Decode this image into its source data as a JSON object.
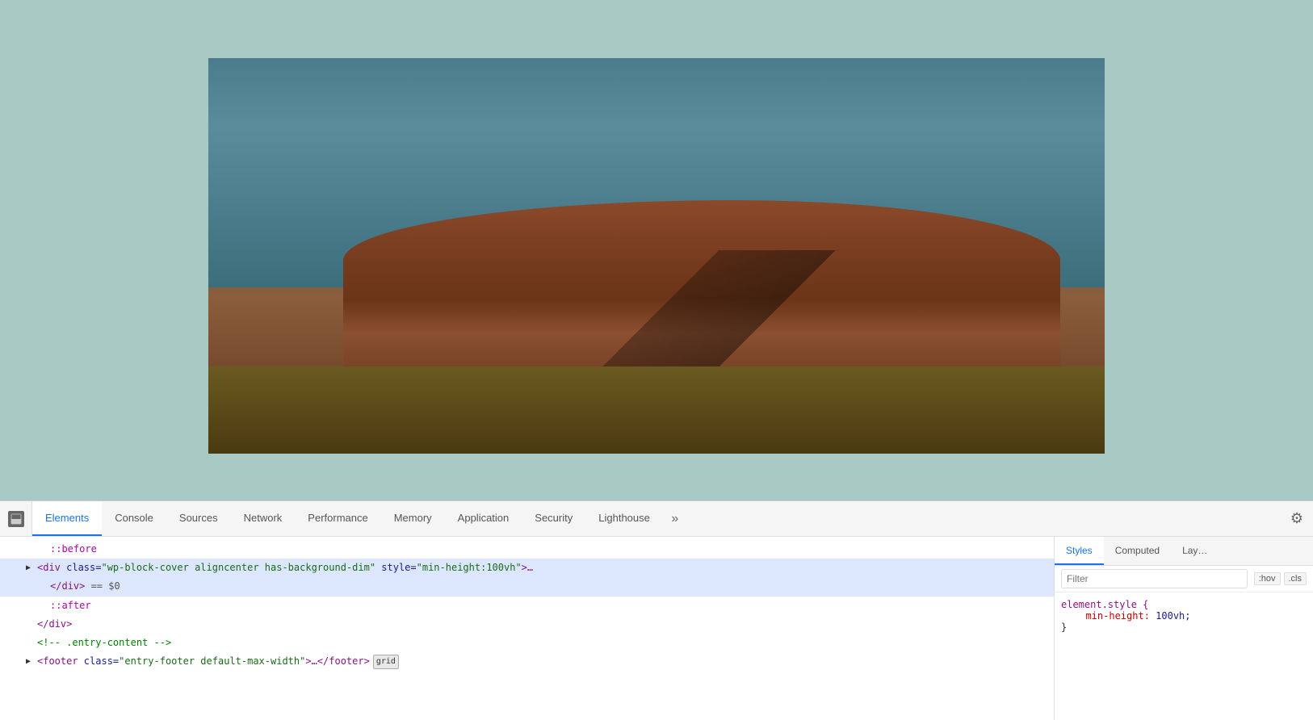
{
  "viewport": {
    "bg_color": "#a8c8c4"
  },
  "devtools": {
    "tabs": [
      {
        "id": "elements",
        "label": "Elements",
        "active": true
      },
      {
        "id": "console",
        "label": "Console",
        "active": false
      },
      {
        "id": "sources",
        "label": "Sources",
        "active": false
      },
      {
        "id": "network",
        "label": "Network",
        "active": false
      },
      {
        "id": "performance",
        "label": "Performance",
        "active": false
      },
      {
        "id": "memory",
        "label": "Memory",
        "active": false
      },
      {
        "id": "application",
        "label": "Application",
        "active": false
      },
      {
        "id": "security",
        "label": "Security",
        "active": false
      },
      {
        "id": "lighthouse",
        "label": "Lighthouse",
        "active": false
      }
    ],
    "dom": {
      "lines": [
        {
          "indent": 2,
          "content": "::before",
          "type": "pseudo",
          "selected": false
        },
        {
          "indent": 1,
          "content": "",
          "type": "element-open",
          "selected": true,
          "arrow": "▶",
          "tag_open": "<div",
          "attr_name": " class=",
          "attr_value": "\"wp-block-cover aligncenter has-background-dim\"",
          "attr_name2": " style=",
          "attr_value2": "\"min-height:100vh\"",
          "tag_close": ">…"
        },
        {
          "indent": 1,
          "content_pre": "</div>",
          "content_eq": " == $0",
          "type": "closing-eq",
          "selected": true
        },
        {
          "indent": 2,
          "content": "::after",
          "type": "pseudo",
          "selected": false
        },
        {
          "indent": 1,
          "content": "</div>",
          "type": "close-tag",
          "selected": false
        },
        {
          "indent": 1,
          "content": "<!-- .entry-content -->",
          "type": "comment",
          "selected": false
        },
        {
          "indent": 1,
          "content": "",
          "type": "footer",
          "selected": false,
          "arrow": "▶",
          "tag_open": "<footer",
          "attr_name": " class=",
          "attr_value": "\"entry-footer default-max-width\"",
          "tag_close": ">…</footer>",
          "badge": "grid"
        }
      ]
    },
    "styles_panel": {
      "sub_tabs": [
        {
          "label": "Styles",
          "active": true
        },
        {
          "label": "Computed",
          "active": false
        },
        {
          "label": "Lay…",
          "active": false
        }
      ],
      "filter_placeholder": "Filter",
      "filter_btns": [
        ":hov",
        ".cls"
      ],
      "rule": {
        "selector": "element.style {",
        "prop": "min-height:",
        "val": " 100vh;",
        "close": "}"
      }
    }
  }
}
